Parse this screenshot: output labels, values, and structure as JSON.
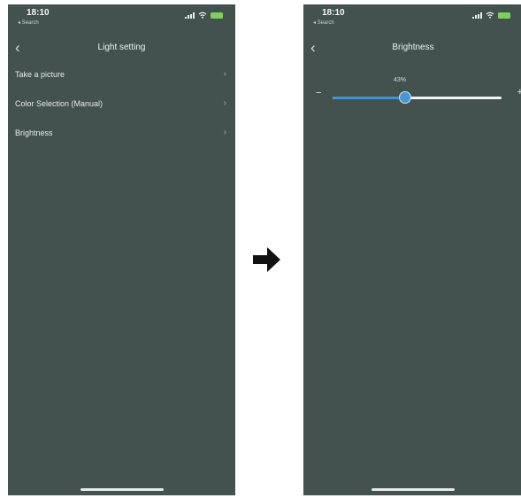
{
  "colors": {
    "screen_background": "#43524e",
    "slider_accent": "#3f95d6",
    "battery": "#7fcf5c"
  },
  "left_screen": {
    "status_bar": {
      "time": "18:10",
      "back_app": "◂ Search"
    },
    "nav": {
      "back_icon": "chevron-left-icon",
      "title": "Light setting"
    },
    "menu_items": [
      {
        "label": "Take a picture",
        "chevron": "›"
      },
      {
        "label": "Color Selection (Manual)",
        "chevron": "›"
      },
      {
        "label": "Brightness",
        "chevron": "›"
      }
    ]
  },
  "transition": {
    "icon": "arrow-right-icon"
  },
  "right_screen": {
    "status_bar": {
      "time": "18:10",
      "back_app": "◂ Search"
    },
    "nav": {
      "back_icon": "chevron-left-icon",
      "title": "Brightness"
    },
    "brightness_slider": {
      "value_label": "43%",
      "value": 0.43,
      "min_label": "−",
      "max_label": "+"
    }
  }
}
